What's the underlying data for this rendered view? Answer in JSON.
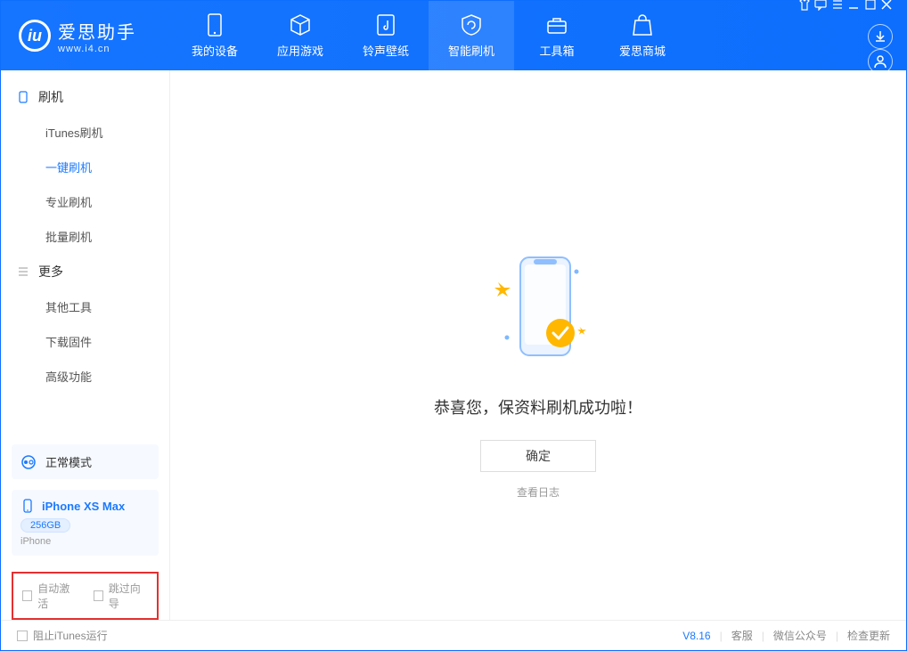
{
  "app": {
    "title": "爱思助手",
    "subtitle": "www.i4.cn"
  },
  "topnav": {
    "items": [
      {
        "label": "我的设备"
      },
      {
        "label": "应用游戏"
      },
      {
        "label": "铃声壁纸"
      },
      {
        "label": "智能刷机"
      },
      {
        "label": "工具箱"
      },
      {
        "label": "爱思商城"
      }
    ],
    "active_index": 3
  },
  "sidebar": {
    "group1": {
      "title": "刷机",
      "items": [
        {
          "label": "iTunes刷机"
        },
        {
          "label": "一键刷机"
        },
        {
          "label": "专业刷机"
        },
        {
          "label": "批量刷机"
        }
      ],
      "active_index": 1
    },
    "group2": {
      "title": "更多",
      "items": [
        {
          "label": "其他工具"
        },
        {
          "label": "下载固件"
        },
        {
          "label": "高级功能"
        }
      ]
    },
    "mode_panel": {
      "label": "正常模式"
    },
    "device_panel": {
      "name": "iPhone XS Max",
      "storage": "256GB",
      "model": "iPhone"
    },
    "options": {
      "auto_activate": "自动激活",
      "skip_guide": "跳过向导"
    }
  },
  "main": {
    "success_message": "恭喜您，保资料刷机成功啦！",
    "ok_button": "确定",
    "view_log": "查看日志"
  },
  "footer": {
    "block_itunes": "阻止iTunes运行",
    "version": "V8.16",
    "links": {
      "support": "客服",
      "wechat": "微信公众号",
      "check_update": "检查更新"
    }
  }
}
